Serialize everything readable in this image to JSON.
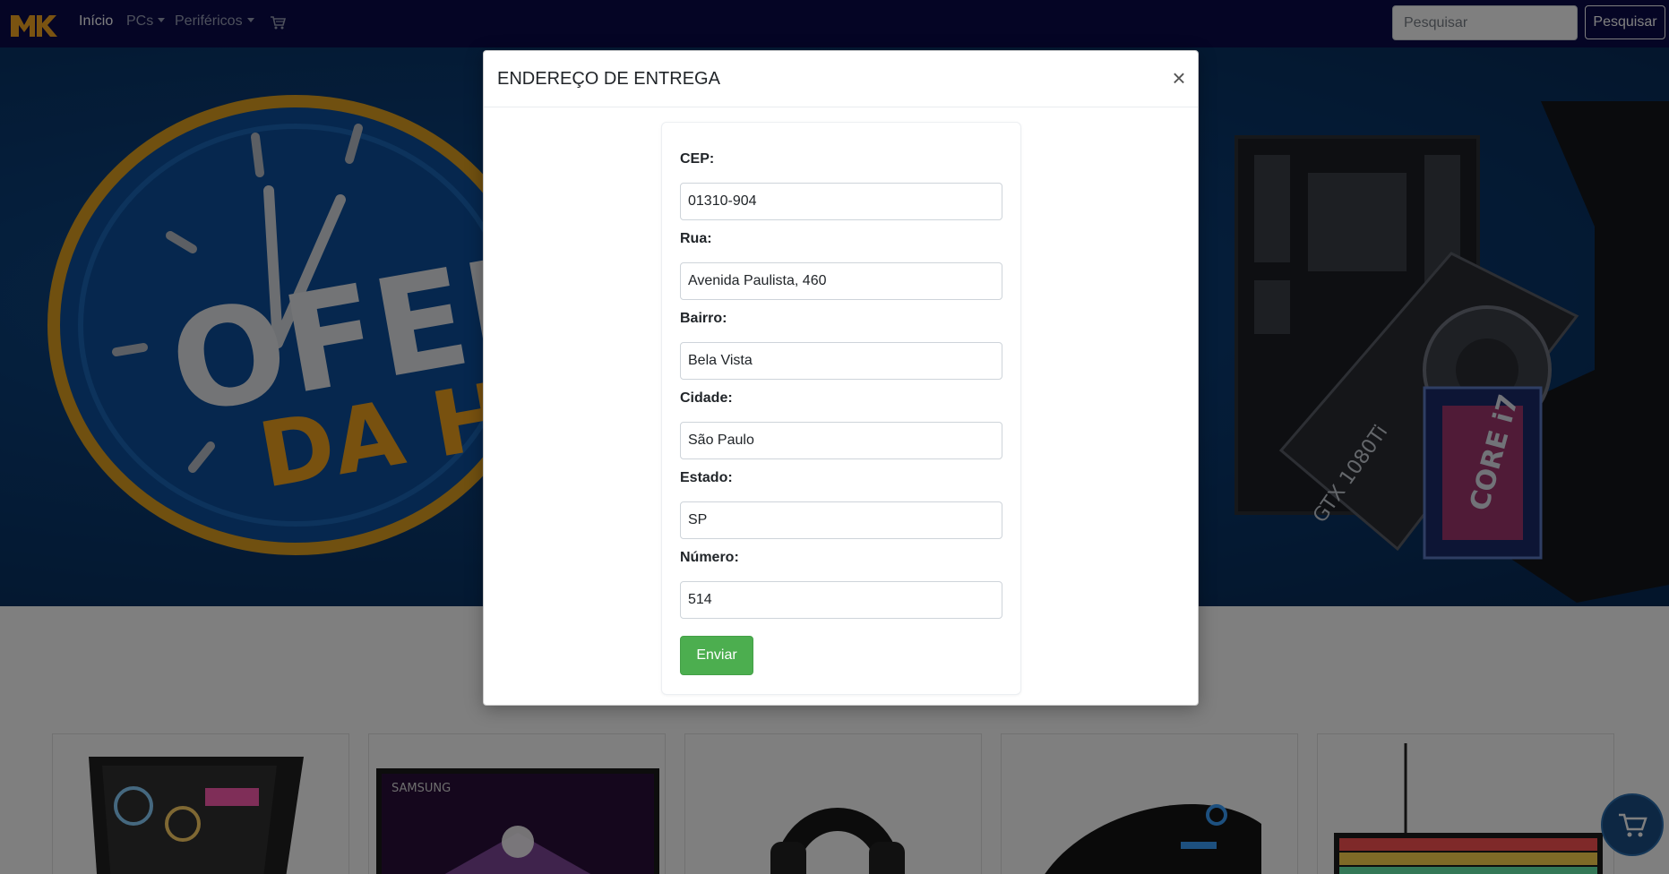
{
  "navbar": {
    "logo_text": "MK",
    "links": [
      {
        "label": "Início"
      },
      {
        "label": "PCs"
      },
      {
        "label": "Periféricos"
      }
    ],
    "search": {
      "placeholder": "Pesquisar",
      "button_label": "Pesquisar"
    }
  },
  "hero": {
    "text_line1": "OFER",
    "text_line2": "DA HO",
    "gpu_text": "GTX 1080Ti",
    "cpu_text": "CORE i7"
  },
  "products": [
    {
      "name": "pc-case"
    },
    {
      "name": "samsung-monitor",
      "brand": "SAMSUNG"
    },
    {
      "name": "headset"
    },
    {
      "name": "mouse"
    },
    {
      "name": "keyboard"
    }
  ],
  "modal": {
    "title": "ENDEREÇO DE ENTREGA",
    "close_glyph": "×",
    "fields": [
      {
        "label": "CEP:",
        "value": "01310-904"
      },
      {
        "label": "Rua:",
        "value": "Avenida Paulista, 460"
      },
      {
        "label": "Bairro:",
        "value": "Bela Vista"
      },
      {
        "label": "Cidade:",
        "value": "São Paulo"
      },
      {
        "label": "Estado:",
        "value": "SP"
      },
      {
        "label": "Número:",
        "value": "514"
      }
    ],
    "submit_label": "Enviar"
  },
  "colors": {
    "navbar_bg": "#0a0a4a",
    "logo": "#f5a623",
    "submit": "#4cae4f",
    "hero_bg": "#0a3a72"
  },
  "icons": [
    "cart-icon",
    "close-icon",
    "floating-cart-icon"
  ]
}
